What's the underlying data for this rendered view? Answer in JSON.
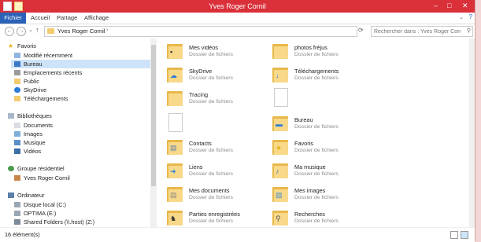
{
  "window": {
    "title": "Yves Roger Cornil"
  },
  "ribbon": {
    "tabs": [
      "Fichier",
      "Accueil",
      "Partage",
      "Affichage"
    ]
  },
  "address": {
    "path": "Yves Roger Cornil",
    "separator": "›",
    "search_placeholder": "Rechercher dans : Yves Roger Cornil"
  },
  "nav": {
    "favorites": {
      "header": "Favoris",
      "items": [
        "Modifié récemment",
        "Bureau",
        "Emplacements récents",
        "Public",
        "SkyDrive",
        "Téléchargements"
      ]
    },
    "libraries": {
      "header": "Bibliothèques",
      "items": [
        "Documents",
        "Images",
        "Musique",
        "Vidéos"
      ]
    },
    "homegroup": {
      "header": "Groupe résidentiel",
      "items": [
        "Yves Roger Cornil"
      ]
    },
    "computer": {
      "header": "Ordinateur",
      "items": [
        "Disque local (C:)",
        "OPTIMA (E:)",
        "Shared Folders (\\\\.host) (Z:)"
      ]
    }
  },
  "items": [
    {
      "name": "Mes vidéos",
      "type": "Dossier de fichiers",
      "icon": "video-folder-icon"
    },
    {
      "name": "photos fréjus",
      "type": "Dossier de fichiers",
      "icon": "folder-icon"
    },
    {
      "name": "SkyDrive",
      "type": "Dossier de fichiers",
      "icon": "skydrive-folder-icon"
    },
    {
      "name": "Téléchargements",
      "type": "Dossier de fichiers",
      "icon": "downloads-folder-icon"
    },
    {
      "name": "Tracing",
      "type": "Dossier de fichiers",
      "icon": "folder-icon"
    },
    {
      "name": "",
      "type": "",
      "icon": "file-icon"
    },
    {
      "name": "",
      "type": "",
      "icon": "file-icon"
    },
    {
      "name": "Bureau",
      "type": "Dossier de fichiers",
      "icon": "desktop-folder-icon"
    },
    {
      "name": "Contacts",
      "type": "Dossier de fichiers",
      "icon": "contacts-folder-icon"
    },
    {
      "name": "Favoris",
      "type": "Dossier de fichiers",
      "icon": "favorites-folder-icon"
    },
    {
      "name": "Liens",
      "type": "Dossier de fichiers",
      "icon": "links-folder-icon"
    },
    {
      "name": "Ma musique",
      "type": "Dossier de fichiers",
      "icon": "music-folder-icon"
    },
    {
      "name": "Mes documents",
      "type": "Dossier de fichiers",
      "icon": "documents-folder-icon"
    },
    {
      "name": "Mes images",
      "type": "Dossier de fichiers",
      "icon": "pictures-folder-icon"
    },
    {
      "name": "Parties enregistrées",
      "type": "Dossier de fichiers",
      "icon": "saved-games-folder-icon"
    },
    {
      "name": "Recherches",
      "type": "Dossier de fichiers",
      "icon": "searches-folder-icon"
    }
  ],
  "status": {
    "count": "16 élément(s)"
  },
  "colors": {
    "titlebar": "#d9303a",
    "file_tab": "#2a62b8",
    "selection": "#cde3f7",
    "folder": "#f2cc6e"
  }
}
